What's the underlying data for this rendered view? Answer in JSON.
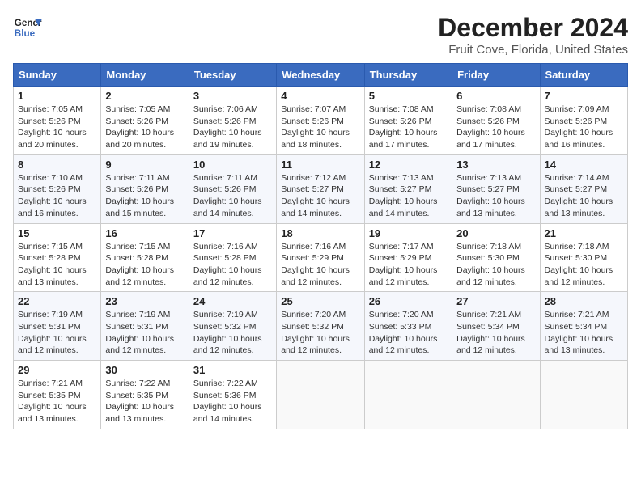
{
  "logo": {
    "line1": "General",
    "line2": "Blue"
  },
  "title": "December 2024",
  "location": "Fruit Cove, Florida, United States",
  "weekdays": [
    "Sunday",
    "Monday",
    "Tuesday",
    "Wednesday",
    "Thursday",
    "Friday",
    "Saturday"
  ],
  "weeks": [
    [
      {
        "day": "1",
        "sunrise": "7:05 AM",
        "sunset": "5:26 PM",
        "daylight": "10 hours and 20 minutes."
      },
      {
        "day": "2",
        "sunrise": "7:05 AM",
        "sunset": "5:26 PM",
        "daylight": "10 hours and 20 minutes."
      },
      {
        "day": "3",
        "sunrise": "7:06 AM",
        "sunset": "5:26 PM",
        "daylight": "10 hours and 19 minutes."
      },
      {
        "day": "4",
        "sunrise": "7:07 AM",
        "sunset": "5:26 PM",
        "daylight": "10 hours and 18 minutes."
      },
      {
        "day": "5",
        "sunrise": "7:08 AM",
        "sunset": "5:26 PM",
        "daylight": "10 hours and 17 minutes."
      },
      {
        "day": "6",
        "sunrise": "7:08 AM",
        "sunset": "5:26 PM",
        "daylight": "10 hours and 17 minutes."
      },
      {
        "day": "7",
        "sunrise": "7:09 AM",
        "sunset": "5:26 PM",
        "daylight": "10 hours and 16 minutes."
      }
    ],
    [
      {
        "day": "8",
        "sunrise": "7:10 AM",
        "sunset": "5:26 PM",
        "daylight": "10 hours and 16 minutes."
      },
      {
        "day": "9",
        "sunrise": "7:11 AM",
        "sunset": "5:26 PM",
        "daylight": "10 hours and 15 minutes."
      },
      {
        "day": "10",
        "sunrise": "7:11 AM",
        "sunset": "5:26 PM",
        "daylight": "10 hours and 14 minutes."
      },
      {
        "day": "11",
        "sunrise": "7:12 AM",
        "sunset": "5:27 PM",
        "daylight": "10 hours and 14 minutes."
      },
      {
        "day": "12",
        "sunrise": "7:13 AM",
        "sunset": "5:27 PM",
        "daylight": "10 hours and 14 minutes."
      },
      {
        "day": "13",
        "sunrise": "7:13 AM",
        "sunset": "5:27 PM",
        "daylight": "10 hours and 13 minutes."
      },
      {
        "day": "14",
        "sunrise": "7:14 AM",
        "sunset": "5:27 PM",
        "daylight": "10 hours and 13 minutes."
      }
    ],
    [
      {
        "day": "15",
        "sunrise": "7:15 AM",
        "sunset": "5:28 PM",
        "daylight": "10 hours and 13 minutes."
      },
      {
        "day": "16",
        "sunrise": "7:15 AM",
        "sunset": "5:28 PM",
        "daylight": "10 hours and 12 minutes."
      },
      {
        "day": "17",
        "sunrise": "7:16 AM",
        "sunset": "5:28 PM",
        "daylight": "10 hours and 12 minutes."
      },
      {
        "day": "18",
        "sunrise": "7:16 AM",
        "sunset": "5:29 PM",
        "daylight": "10 hours and 12 minutes."
      },
      {
        "day": "19",
        "sunrise": "7:17 AM",
        "sunset": "5:29 PM",
        "daylight": "10 hours and 12 minutes."
      },
      {
        "day": "20",
        "sunrise": "7:18 AM",
        "sunset": "5:30 PM",
        "daylight": "10 hours and 12 minutes."
      },
      {
        "day": "21",
        "sunrise": "7:18 AM",
        "sunset": "5:30 PM",
        "daylight": "10 hours and 12 minutes."
      }
    ],
    [
      {
        "day": "22",
        "sunrise": "7:19 AM",
        "sunset": "5:31 PM",
        "daylight": "10 hours and 12 minutes."
      },
      {
        "day": "23",
        "sunrise": "7:19 AM",
        "sunset": "5:31 PM",
        "daylight": "10 hours and 12 minutes."
      },
      {
        "day": "24",
        "sunrise": "7:19 AM",
        "sunset": "5:32 PM",
        "daylight": "10 hours and 12 minutes."
      },
      {
        "day": "25",
        "sunrise": "7:20 AM",
        "sunset": "5:32 PM",
        "daylight": "10 hours and 12 minutes."
      },
      {
        "day": "26",
        "sunrise": "7:20 AM",
        "sunset": "5:33 PM",
        "daylight": "10 hours and 12 minutes."
      },
      {
        "day": "27",
        "sunrise": "7:21 AM",
        "sunset": "5:34 PM",
        "daylight": "10 hours and 12 minutes."
      },
      {
        "day": "28",
        "sunrise": "7:21 AM",
        "sunset": "5:34 PM",
        "daylight": "10 hours and 13 minutes."
      }
    ],
    [
      {
        "day": "29",
        "sunrise": "7:21 AM",
        "sunset": "5:35 PM",
        "daylight": "10 hours and 13 minutes."
      },
      {
        "day": "30",
        "sunrise": "7:22 AM",
        "sunset": "5:35 PM",
        "daylight": "10 hours and 13 minutes."
      },
      {
        "day": "31",
        "sunrise": "7:22 AM",
        "sunset": "5:36 PM",
        "daylight": "10 hours and 14 minutes."
      },
      null,
      null,
      null,
      null
    ]
  ],
  "labels": {
    "sunrise": "Sunrise:",
    "sunset": "Sunset:",
    "daylight": "Daylight:"
  }
}
